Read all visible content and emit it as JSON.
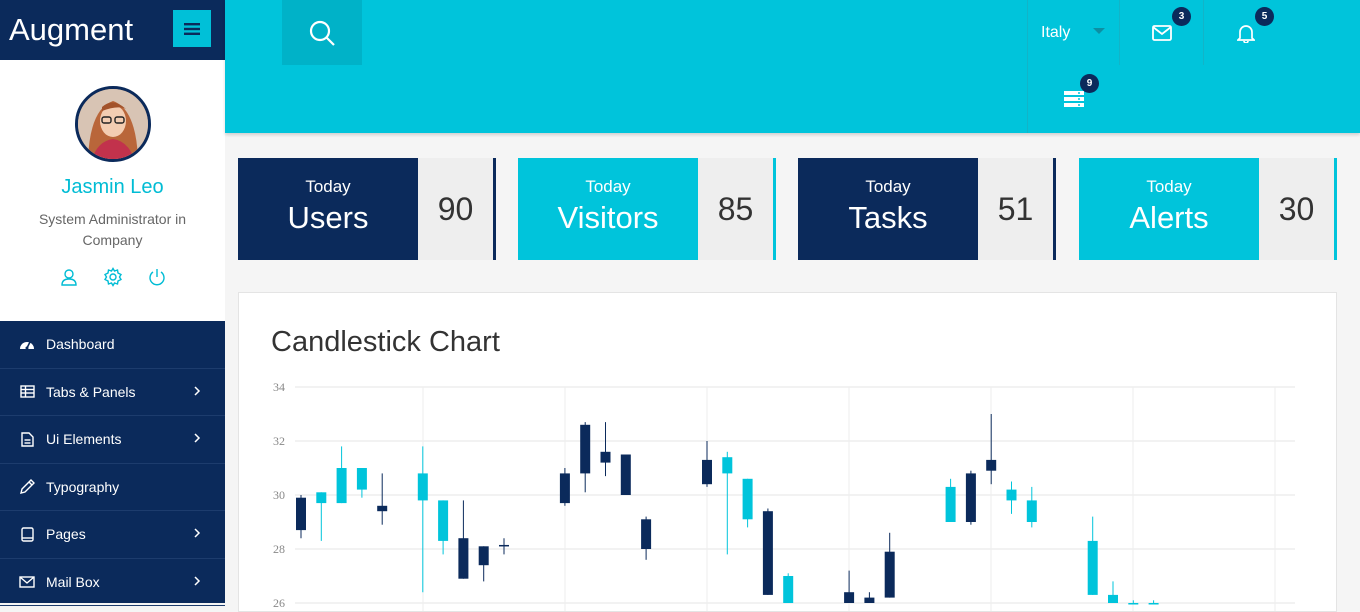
{
  "brand": {
    "name": "Augment",
    "menu_icon": "hamburger-icon"
  },
  "profile": {
    "name": "Jasmin Leo",
    "role": "System Administrator in Company",
    "actions": [
      "user-icon",
      "gear-icon",
      "power-icon"
    ]
  },
  "nav": {
    "items": [
      {
        "label": "Dashboard",
        "icon": "dashboard-icon",
        "has_chevron": false
      },
      {
        "label": "Tabs & Panels",
        "icon": "table-icon",
        "has_chevron": true
      },
      {
        "label": "Ui Elements",
        "icon": "file-icon",
        "has_chevron": true
      },
      {
        "label": "Typography",
        "icon": "pencil-icon",
        "has_chevron": false
      },
      {
        "label": "Pages",
        "icon": "page-icon",
        "has_chevron": true
      },
      {
        "label": "Mail Box",
        "icon": "mail-icon",
        "has_chevron": true
      }
    ]
  },
  "topbar": {
    "language": "Italy",
    "mail_count": "3",
    "notification_count": "5",
    "tasks_count": "9"
  },
  "stats": [
    {
      "caption": "Today",
      "label": "Users",
      "value": "90",
      "color": "#0b2a5b"
    },
    {
      "caption": "Today",
      "label": "Visitors",
      "value": "85",
      "color": "#00c4db"
    },
    {
      "caption": "Today",
      "label": "Tasks",
      "value": "51",
      "color": "#0b2a5b"
    },
    {
      "caption": "Today",
      "label": "Alerts",
      "value": "30",
      "color": "#00c4db"
    }
  ],
  "colors": {
    "navy": "#0b2a5b",
    "cyan": "#00c4db"
  },
  "chart": {
    "title": "Candlestick Chart"
  },
  "chart_data": {
    "type": "candlestick",
    "title": "Candlestick Chart",
    "ylim": [
      26,
      34
    ],
    "yticks": [
      "34",
      "32",
      "30",
      "28",
      "26"
    ],
    "grid": true,
    "candles": [
      {
        "i": 0,
        "open": 29.9,
        "close": 28.7,
        "high": 30.0,
        "low": 28.4
      },
      {
        "i": 1,
        "open": 29.7,
        "close": 30.1,
        "high": 30.1,
        "low": 28.3
      },
      {
        "i": 2,
        "open": 29.7,
        "close": 31.0,
        "high": 31.8,
        "low": 29.7
      },
      {
        "i": 3,
        "open": 30.2,
        "close": 31.0,
        "high": 31.0,
        "low": 29.9
      },
      {
        "i": 4,
        "open": 29.6,
        "close": 29.4,
        "high": 30.8,
        "low": 28.9
      },
      {
        "i": 6,
        "open": 29.8,
        "close": 30.8,
        "high": 31.8,
        "low": 26.4
      },
      {
        "i": 7,
        "open": 28.3,
        "close": 29.8,
        "high": 29.8,
        "low": 27.8
      },
      {
        "i": 8,
        "open": 28.4,
        "close": 26.9,
        "high": 29.8,
        "low": 26.9
      },
      {
        "i": 9,
        "open": 28.1,
        "close": 27.4,
        "high": 28.1,
        "low": 26.8
      },
      {
        "i": 10,
        "open": 28.15,
        "close": 28.1,
        "high": 28.4,
        "low": 27.8
      },
      {
        "i": 13,
        "open": 30.8,
        "close": 29.7,
        "high": 31.0,
        "low": 29.6
      },
      {
        "i": 14,
        "open": 32.6,
        "close": 30.8,
        "high": 32.7,
        "low": 30.1
      },
      {
        "i": 15,
        "open": 31.6,
        "close": 31.2,
        "high": 32.7,
        "low": 30.7
      },
      {
        "i": 16,
        "open": 31.5,
        "close": 30.0,
        "high": 31.5,
        "low": 30.0
      },
      {
        "i": 17,
        "open": 29.1,
        "close": 28.0,
        "high": 29.2,
        "low": 27.6
      },
      {
        "i": 20,
        "open": 31.3,
        "close": 30.4,
        "high": 32.0,
        "low": 30.3
      },
      {
        "i": 21,
        "open": 30.8,
        "close": 31.4,
        "high": 31.6,
        "low": 27.8
      },
      {
        "i": 22,
        "open": 29.1,
        "close": 30.6,
        "high": 30.6,
        "low": 28.8
      },
      {
        "i": 23,
        "open": 29.4,
        "close": 26.3,
        "high": 29.5,
        "low": 26.3
      },
      {
        "i": 24,
        "open": 26.0,
        "close": 27.0,
        "high": 27.1,
        "low": 26.0
      },
      {
        "i": 27,
        "open": 26.4,
        "close": 26.0,
        "high": 27.2,
        "low": 26.0
      },
      {
        "i": 28,
        "open": 26.2,
        "close": 26.0,
        "high": 26.4,
        "low": 26.0
      },
      {
        "i": 29,
        "open": 27.9,
        "close": 26.2,
        "high": 28.6,
        "low": 26.2
      },
      {
        "i": 32,
        "open": 29.0,
        "close": 30.3,
        "high": 30.6,
        "low": 29.0
      },
      {
        "i": 33,
        "open": 30.8,
        "close": 29.0,
        "high": 30.9,
        "low": 28.9
      },
      {
        "i": 34,
        "open": 31.3,
        "close": 30.9,
        "high": 33.0,
        "low": 30.4
      },
      {
        "i": 35,
        "open": 29.8,
        "close": 30.2,
        "high": 30.5,
        "low": 29.3
      },
      {
        "i": 36,
        "open": 29.0,
        "close": 29.8,
        "high": 30.3,
        "low": 28.8
      },
      {
        "i": 39,
        "open": 26.3,
        "close": 28.3,
        "high": 29.2,
        "low": 26.3
      },
      {
        "i": 40,
        "open": 26.0,
        "close": 26.3,
        "high": 26.8,
        "low": 26.0
      },
      {
        "i": 41,
        "open": 26.0,
        "close": 26.0,
        "high": 26.1,
        "low": 26.0
      },
      {
        "i": 42,
        "open": 26.0,
        "close": 26.0,
        "high": 26.1,
        "low": 26.0
      }
    ]
  }
}
